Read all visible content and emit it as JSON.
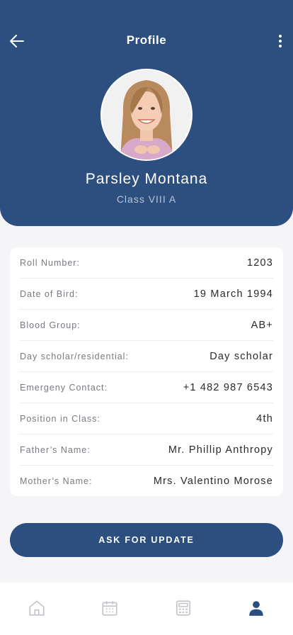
{
  "header": {
    "title": "Profile"
  },
  "profile": {
    "name": "Parsley Montana",
    "class": "Class VIII A"
  },
  "details": [
    {
      "label": "Roll Number:",
      "value": "1203"
    },
    {
      "label": "Date of Bird:",
      "value": "19 March 1994"
    },
    {
      "label": "Blood Group:",
      "value": "AB+"
    },
    {
      "label": "Day scholar/residential:",
      "value": "Day scholar"
    },
    {
      "label": "Emergeny Contact:",
      "value": "+1 482 987 6543"
    },
    {
      "label": "Position in Class:",
      "value": "4th"
    },
    {
      "label": "Father’s Name:",
      "value": "Mr. Phillip Anthropy"
    },
    {
      "label": "Mother’s Name:",
      "value": "Mrs. Valentino Morose"
    }
  ],
  "actions": {
    "update_label": "ASK FOR UPDATE"
  },
  "bottom_nav": {
    "items": [
      {
        "icon": "home-icon",
        "active": false
      },
      {
        "icon": "calendar-icon",
        "active": false
      },
      {
        "icon": "calculator-icon",
        "active": false
      },
      {
        "icon": "user-icon",
        "active": true
      }
    ]
  },
  "colors": {
    "primary": "#2c4f80",
    "inactive_icon": "#c4c6cc",
    "background": "#f5f5f7"
  }
}
